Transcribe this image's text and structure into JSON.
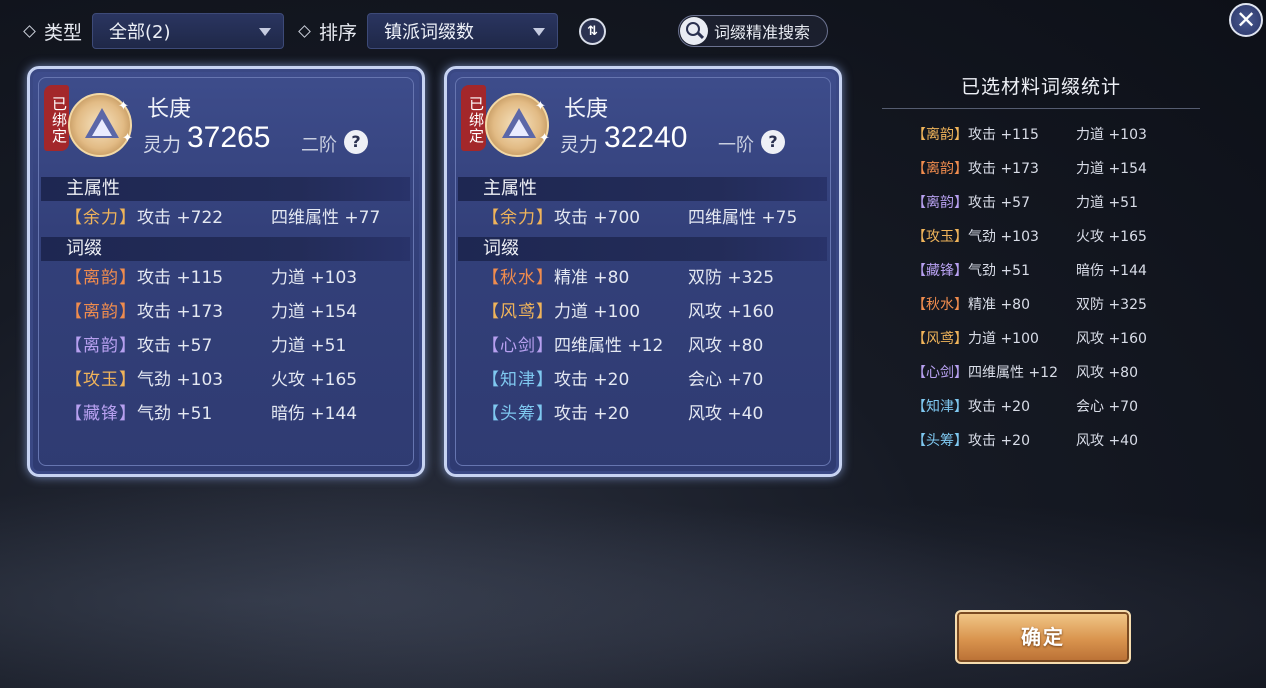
{
  "topbar": {
    "type_label": "类型",
    "type_value": "全部(2)",
    "sort_label": "排序",
    "sort_value": "镇派词缀数",
    "search_label": "词缀精准搜索",
    "close_glyph": "✕"
  },
  "colors": {
    "gold": "#f0b45a",
    "orange": "#f08c4e",
    "purple": "#b7a0f0",
    "cyan": "#7fc8f0",
    "bound": "#a3272a"
  },
  "cards": [
    {
      "bound_label": "已绑定",
      "name": "长庚",
      "power_label": "灵力",
      "power": "37265",
      "tier": "二阶",
      "help": "?",
      "main_heading": "主属性",
      "main": {
        "tag": "【余力】",
        "color": "#f0b45a",
        "stat1": "攻击 +722",
        "stat2": "四维属性 +77"
      },
      "affix_heading": "词缀",
      "affixes": [
        {
          "tag": "【离韵】",
          "color": "#f08c4e",
          "stat1": "攻击 +115",
          "stat2": "力道 +103"
        },
        {
          "tag": "【离韵】",
          "color": "#f08c4e",
          "stat1": "攻击 +173",
          "stat2": "力道 +154"
        },
        {
          "tag": "【离韵】",
          "color": "#b7a0f0",
          "stat1": "攻击 +57",
          "stat2": "力道 +51"
        },
        {
          "tag": "【攻玉】",
          "color": "#f0b45a",
          "stat1": "气劲 +103",
          "stat2": "火攻 +165"
        },
        {
          "tag": "【藏锋】",
          "color": "#b7a0f0",
          "stat1": "气劲 +51",
          "stat2": "暗伤 +144"
        }
      ]
    },
    {
      "bound_label": "已绑定",
      "name": "长庚",
      "power_label": "灵力",
      "power": "32240",
      "tier": "一阶",
      "help": "?",
      "main_heading": "主属性",
      "main": {
        "tag": "【余力】",
        "color": "#f0b45a",
        "stat1": "攻击 +700",
        "stat2": "四维属性 +75"
      },
      "affix_heading": "词缀",
      "affixes": [
        {
          "tag": "【秋水】",
          "color": "#f08c4e",
          "stat1": "精准 +80",
          "stat2": "双防 +325"
        },
        {
          "tag": "【风鸢】",
          "color": "#f0b45a",
          "stat1": "力道 +100",
          "stat2": "风攻 +160"
        },
        {
          "tag": "【心剑】",
          "color": "#b7a0f0",
          "stat1": "四维属性 +12",
          "stat2": "风攻 +80"
        },
        {
          "tag": "【知津】",
          "color": "#7fc8f0",
          "stat1": "攻击 +20",
          "stat2": "会心 +70"
        },
        {
          "tag": "【头筹】",
          "color": "#7fc8f0",
          "stat1": "攻击 +20",
          "stat2": "风攻 +40"
        }
      ]
    }
  ],
  "stats": {
    "title": "已选材料词缀统计",
    "rows": [
      {
        "tag": "【离韵】",
        "color": "#f0b45a",
        "stat1": "攻击 +115",
        "stat2": "力道 +103"
      },
      {
        "tag": "【离韵】",
        "color": "#f08c4e",
        "stat1": "攻击 +173",
        "stat2": "力道 +154"
      },
      {
        "tag": "【离韵】",
        "color": "#b7a0f0",
        "stat1": "攻击 +57",
        "stat2": "力道 +51"
      },
      {
        "tag": "【攻玉】",
        "color": "#f0b45a",
        "stat1": "气劲 +103",
        "stat2": "火攻 +165"
      },
      {
        "tag": "【藏锋】",
        "color": "#b7a0f0",
        "stat1": "气劲 +51",
        "stat2": "暗伤 +144"
      },
      {
        "tag": "【秋水】",
        "color": "#f08c4e",
        "stat1": "精准 +80",
        "stat2": "双防 +325"
      },
      {
        "tag": "【风鸢】",
        "color": "#f0b45a",
        "stat1": "力道 +100",
        "stat2": "风攻 +160"
      },
      {
        "tag": "【心剑】",
        "color": "#b7a0f0",
        "stat1": "四维属性 +12",
        "stat2": "风攻 +80"
      },
      {
        "tag": "【知津】",
        "color": "#7fc8f0",
        "stat1": "攻击 +20",
        "stat2": "会心 +70"
      },
      {
        "tag": "【头筹】",
        "color": "#7fc8f0",
        "stat1": "攻击 +20",
        "stat2": "风攻 +40"
      }
    ]
  },
  "confirm_label": "确定"
}
